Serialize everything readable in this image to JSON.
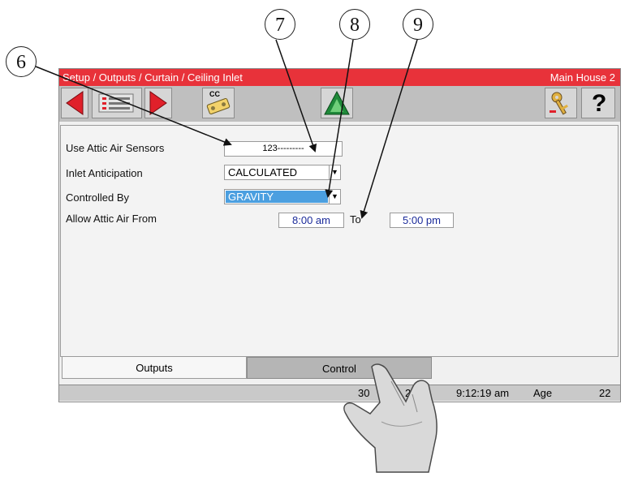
{
  "callouts": [
    "6",
    "7",
    "8",
    "9"
  ],
  "titlebar": {
    "breadcrumb": "Setup / Outputs / Curtain / Ceiling Inlet",
    "location": "Main House 2"
  },
  "toolbar": {
    "cc_label": "CC",
    "help_label": "?"
  },
  "form": {
    "use_attic_label": "Use Attic Air Sensors",
    "use_attic_value": "123---------",
    "inlet_anticipation_label": "Inlet Anticipation",
    "inlet_anticipation_value": "CALCULATED",
    "controlled_by_label": "Controlled By",
    "controlled_by_value": "GRAVITY",
    "allow_attic_label": "Allow Attic Air From",
    "allow_from_value": "8:00 am",
    "to_label": "To",
    "allow_to_value": "5:00 pm"
  },
  "tabs": [
    {
      "label": "Outputs"
    },
    {
      "label": "Control"
    }
  ],
  "status": {
    "date": "30",
    "year": "2010",
    "time": "9:12:19 am",
    "age_label": "Age",
    "age_value": "22"
  },
  "colors": {
    "titlebar": "#e8323a",
    "selection": "#4b9fe0",
    "arrow_red": "#e0202a",
    "alarm_green": "#1f8a3a"
  }
}
